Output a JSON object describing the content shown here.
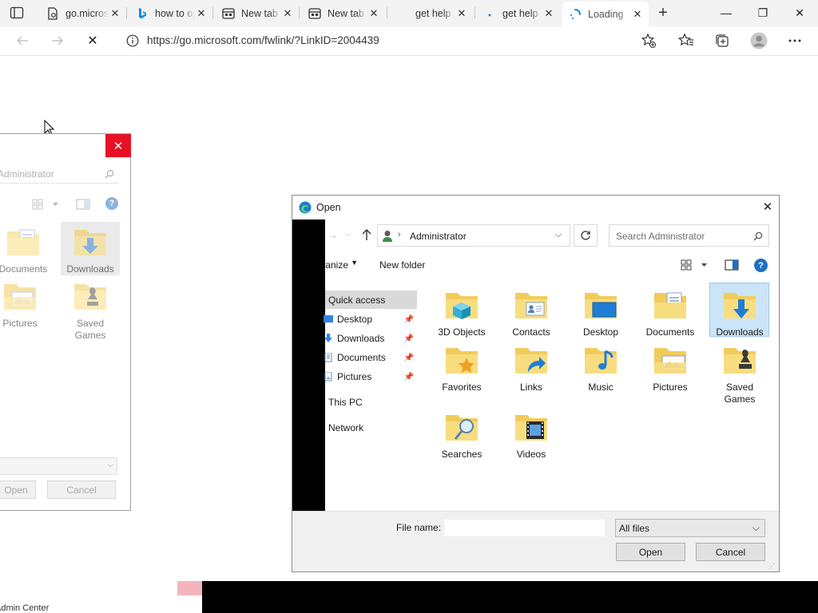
{
  "browser": {
    "tabs": [
      {
        "label": "go.microsoft.com",
        "icon": "page-icon"
      },
      {
        "label": "how to open",
        "icon": "bing-icon"
      },
      {
        "label": "New tab",
        "icon": "newtab-icon"
      },
      {
        "label": "New tab",
        "icon": "newtab-icon"
      },
      {
        "label": "get help",
        "icon": "blank-icon"
      },
      {
        "label": "get help",
        "icon": "blank-icon"
      },
      {
        "label": "Loading",
        "icon": "spinner-icon"
      }
    ],
    "new_tab_label": "+",
    "window_buttons": {
      "minimize": "—",
      "restore": "❐",
      "close": "✕"
    },
    "address": "https://go.microsoft.com/fwlink/?LinkID=2004439",
    "stop_glyph": "✕",
    "accent": "#0078d4"
  },
  "back_dialog": {
    "search_placeholder": "Administrator",
    "items": [
      {
        "label": "Documents",
        "icon": "documents-folder-icon"
      },
      {
        "label": "Downloads",
        "icon": "downloads-folder-icon"
      },
      {
        "label": "Pictures",
        "icon": "pictures-folder-icon"
      },
      {
        "label": "Saved Games",
        "icon": "saved-games-folder-icon"
      }
    ],
    "open_label": "Open",
    "cancel_label": "Cancel",
    "close_glyph": "✕"
  },
  "open_dialog": {
    "title": "Open",
    "close_glyph": "✕",
    "breadcrumb": "Administrator",
    "search_placeholder": "Search Administrator",
    "organize_label": "Organize",
    "new_folder_label": "New folder",
    "nav": {
      "quick_access": "Quick access",
      "pinned": [
        {
          "label": "Desktop",
          "icon": "desktop-small-icon"
        },
        {
          "label": "Downloads",
          "icon": "downloads-small-icon"
        },
        {
          "label": "Documents",
          "icon": "documents-small-icon"
        },
        {
          "label": "Pictures",
          "icon": "pictures-small-icon"
        }
      ],
      "this_pc": "This PC",
      "network": "Network"
    },
    "items": [
      {
        "label": "3D Objects",
        "icon": "3d-objects-folder-icon"
      },
      {
        "label": "Contacts",
        "icon": "contacts-folder-icon"
      },
      {
        "label": "Desktop",
        "icon": "desktop-folder-icon"
      },
      {
        "label": "Documents",
        "icon": "documents-folder-icon"
      },
      {
        "label": "Downloads",
        "icon": "downloads-folder-icon",
        "selected": true
      },
      {
        "label": "Favorites",
        "icon": "favorites-folder-icon"
      },
      {
        "label": "Links",
        "icon": "links-folder-icon"
      },
      {
        "label": "Music",
        "icon": "music-folder-icon"
      },
      {
        "label": "Pictures",
        "icon": "pictures-folder-icon"
      },
      {
        "label": "Saved Games",
        "icon": "saved-games-folder-icon"
      },
      {
        "label": "Searches",
        "icon": "searches-folder-icon"
      },
      {
        "label": "Videos",
        "icon": "videos-folder-icon"
      }
    ],
    "file_name_label": "File name:",
    "file_name_value": "",
    "file_type": "All files",
    "open_label": "Open",
    "cancel_label": "Cancel"
  },
  "taskbar": {
    "admin_center_label": "Admin Center"
  }
}
